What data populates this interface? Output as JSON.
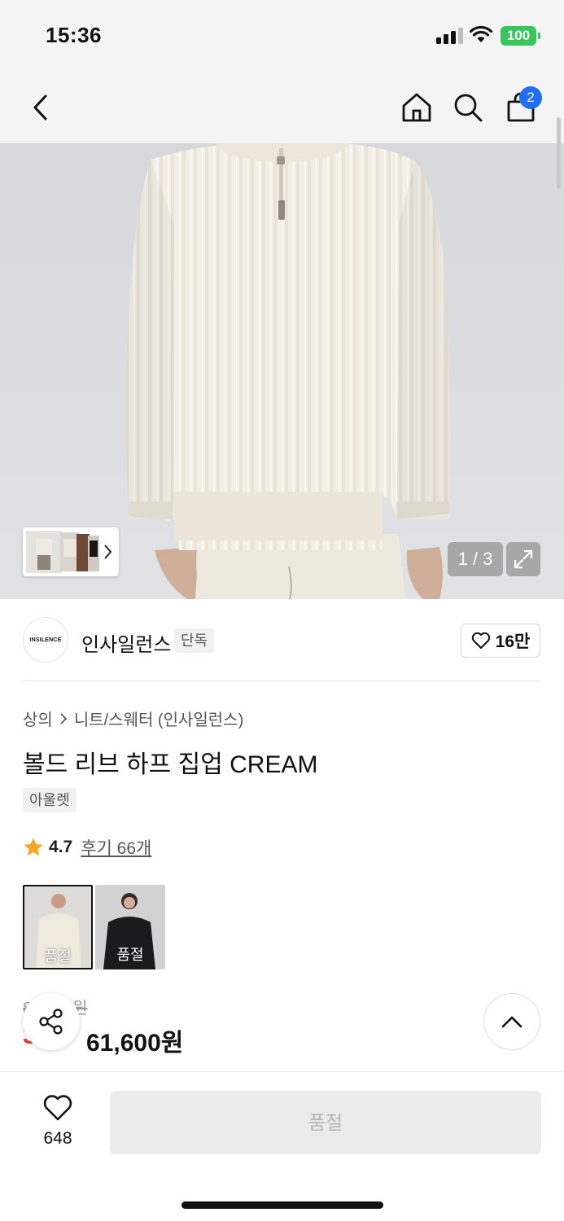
{
  "status_bar": {
    "time": "15:36",
    "battery": "100"
  },
  "header": {
    "cart_count": "2"
  },
  "gallery": {
    "counter": "1 / 3"
  },
  "brand": {
    "logo_text": "INSILENCE",
    "name": "인사일런스",
    "exclusive_tag": "단독",
    "likes": "16만"
  },
  "breadcrumb": {
    "category": "상의",
    "subcategory": "니트/스웨터 (인사일런스)"
  },
  "product": {
    "title": "볼드 리브 하프 집업 CREAM",
    "outlet_tag": "아울렛",
    "rating": "4.7",
    "reviews": "후기 66개",
    "original_price": "88,000원",
    "discount": "30%",
    "price": "61,600원"
  },
  "variants": [
    {
      "label": "품절",
      "color": "#ece6da"
    },
    {
      "label": "품절",
      "color": "#1b1b1d"
    }
  ],
  "bottom_bar": {
    "wishlist_count": "648",
    "buy_button": "품절"
  },
  "colors": {
    "accent_blue": "#1f6ef5",
    "discount_red": "#f23a2f",
    "star": "#f5a623",
    "battery_green": "#35c759"
  }
}
